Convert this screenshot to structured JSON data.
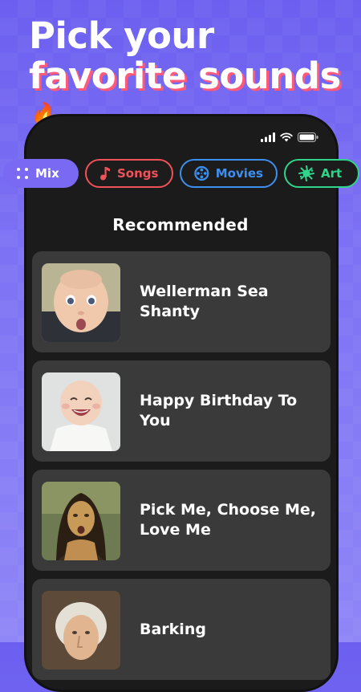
{
  "headline": {
    "line1": "Pick your",
    "line2": "favorite sounds",
    "emoji": "🔥"
  },
  "status_bar": {
    "icons": [
      "signal-icon",
      "wifi-icon",
      "battery-icon"
    ]
  },
  "categories": [
    {
      "label": "Mix",
      "icon": "dots-grid-icon",
      "color": "#7a6af3",
      "selected": true
    },
    {
      "label": "Songs",
      "icon": "music-note-icon",
      "color": "#f0525a",
      "selected": false
    },
    {
      "label": "Movies",
      "icon": "film-reel-icon",
      "color": "#3d8ff0",
      "selected": false
    },
    {
      "label": "Art",
      "icon": "paint-splash-icon",
      "color": "#2fd58a",
      "selected": false
    }
  ],
  "section_title": "Recommended",
  "sounds": [
    {
      "title": "Wellerman Sea Shanty",
      "thumb": "baby-surprised-image"
    },
    {
      "title": "Happy Birthday To You",
      "thumb": "baby-laughing-image"
    },
    {
      "title": "Pick Me, Choose Me, Love Me",
      "thumb": "mona-lisa-image"
    },
    {
      "title": "Barking",
      "thumb": "george-washington-image"
    }
  ],
  "colors": {
    "background": "#7a6ef2",
    "phone": "#1b1b1b",
    "card": "#3a3a3a",
    "headline_shadow": "#ff5a7a"
  }
}
